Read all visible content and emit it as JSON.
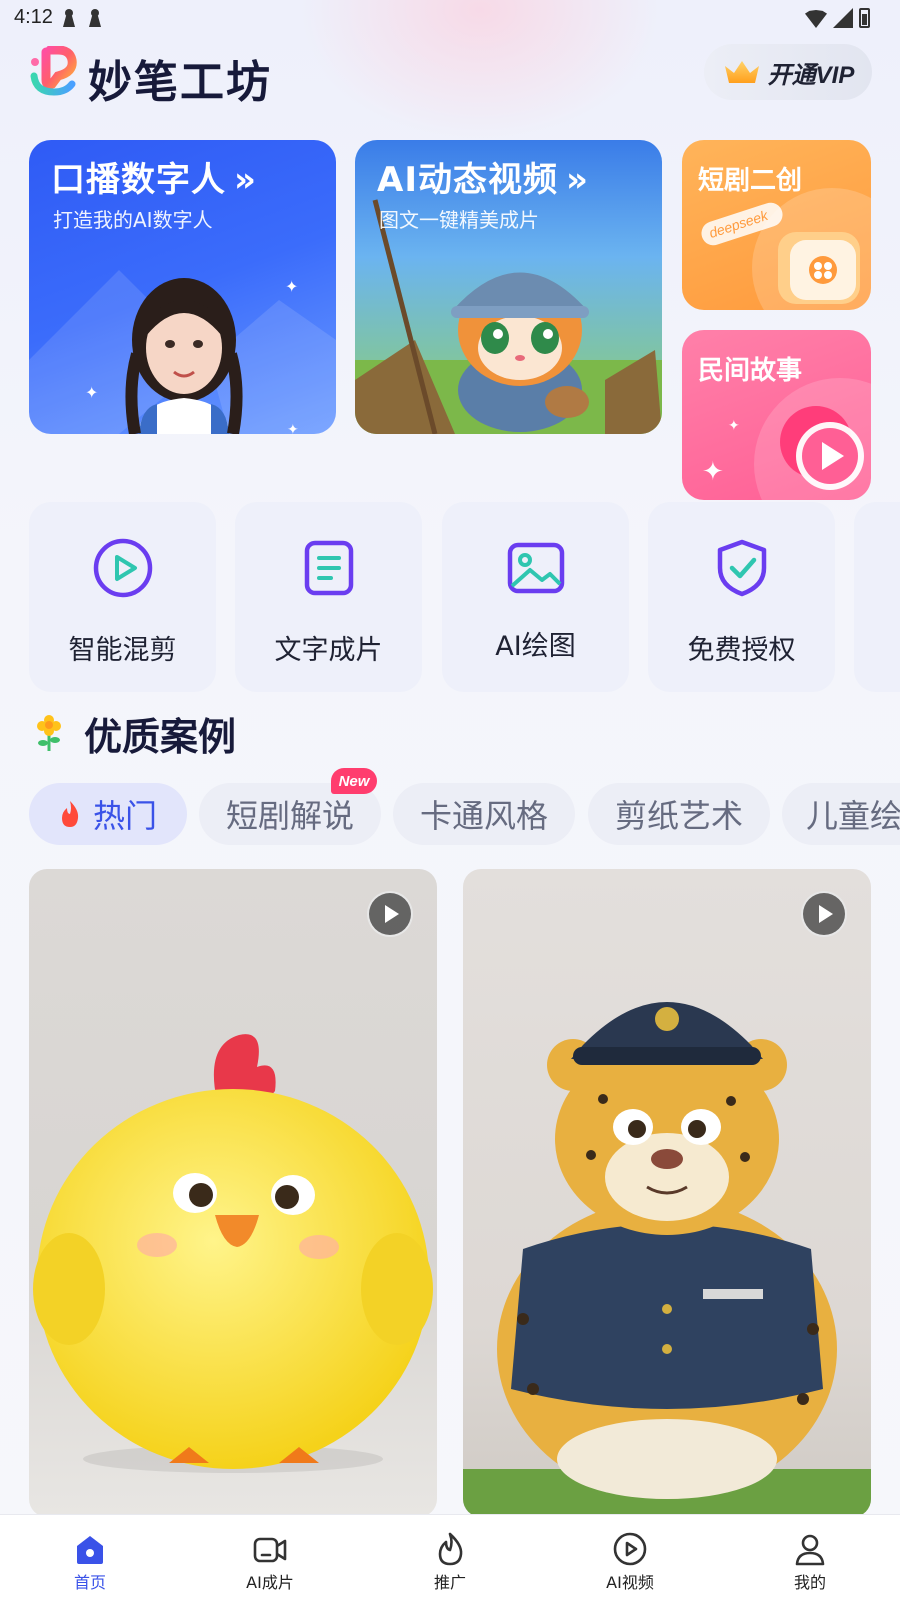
{
  "status_bar": {
    "time": "4:12",
    "left_icons": [
      "pawn-icon",
      "pawn-icon"
    ],
    "right_icons": [
      "wifi-icon",
      "signal-icon",
      "battery-icon"
    ]
  },
  "header": {
    "app_title": "妙笔工坊",
    "logo_icon": "app-logo-icon",
    "vip_label": "开通VIP",
    "vip_icon": "crown-icon"
  },
  "banners": [
    {
      "title": "口播数字人",
      "subtitle": "打造我的AI数字人"
    },
    {
      "title": "AI动态视频",
      "subtitle": "图文一键精美成片"
    },
    {
      "title": "短剧二创",
      "tag": "deepseek"
    },
    {
      "title": "民间故事"
    }
  ],
  "tools": [
    {
      "label": "智能混剪",
      "icon": "play-circle-icon"
    },
    {
      "label": "文字成片",
      "icon": "document-icon"
    },
    {
      "label": "AI绘图",
      "icon": "image-icon"
    },
    {
      "label": "免费授权",
      "icon": "shield-check-icon"
    }
  ],
  "section": {
    "title": "优质案例",
    "icon": "flower-icon"
  },
  "category_tabs": [
    {
      "label": "热门",
      "active": true,
      "icon": "fire-icon"
    },
    {
      "label": "短剧解说",
      "badge": "New"
    },
    {
      "label": "卡通风格"
    },
    {
      "label": "剪纸艺术"
    },
    {
      "label": "儿童绘"
    }
  ],
  "cases": [
    {
      "subject": "yellow-chick",
      "icon": "play-icon"
    },
    {
      "subject": "leopard-police",
      "icon": "play-icon"
    }
  ],
  "bottom_nav": [
    {
      "label": "首页",
      "icon": "home-icon",
      "active": true
    },
    {
      "label": "AI成片",
      "icon": "video-camera-icon"
    },
    {
      "label": "推广",
      "icon": "flame-icon"
    },
    {
      "label": "AI视频",
      "icon": "play-circle-icon"
    },
    {
      "label": "我的",
      "icon": "user-icon"
    }
  ],
  "colors": {
    "accent": "#3a52e8",
    "banner_blue": "#3b6cfb",
    "banner_orange": "#ff9a3c",
    "banner_pink": "#ff5f95",
    "new_badge": "#ff3d6e"
  }
}
